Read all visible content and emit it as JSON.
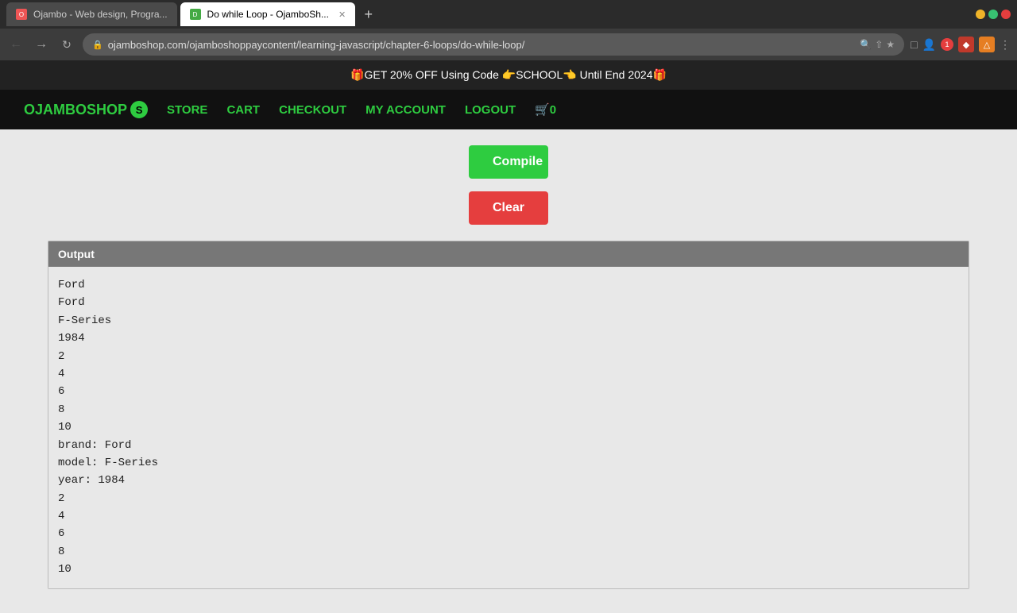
{
  "browser": {
    "tabs": [
      {
        "id": "tab1",
        "favicon_type": "red",
        "label": "Ojambo - Web design, Progra...",
        "active": false
      },
      {
        "id": "tab2",
        "favicon_type": "green",
        "label": "Do while Loop - OjamboSh...",
        "active": true
      }
    ],
    "address": "ojamboshop.com/ojamboshoppaycontent/learning-javascript/chapter-6-loops/do-while-loop/",
    "notification_count": "1"
  },
  "promo_bar": {
    "text": "🎁GET 20% OFF Using Code 👉SCHOOL👈 Until End 2024🎁"
  },
  "nav": {
    "logo_text": "OJAMBOSHOP",
    "logo_letter": "S",
    "links": [
      "STORE",
      "CART",
      "CHECKOUT",
      "MY ACCOUNT",
      "LOGOUT"
    ],
    "cart_label": "🛒0"
  },
  "buttons": {
    "compile_label": "Compile",
    "clear_label": "Clear"
  },
  "output": {
    "header": "Output",
    "lines": [
      "Ford",
      "Ford",
      "F-Series",
      "1984",
      "2",
      "4",
      "6",
      "8",
      "10",
      "brand: Ford",
      "model: F-Series",
      "year: 1984",
      "2",
      "4",
      "6",
      "8",
      "10"
    ]
  }
}
